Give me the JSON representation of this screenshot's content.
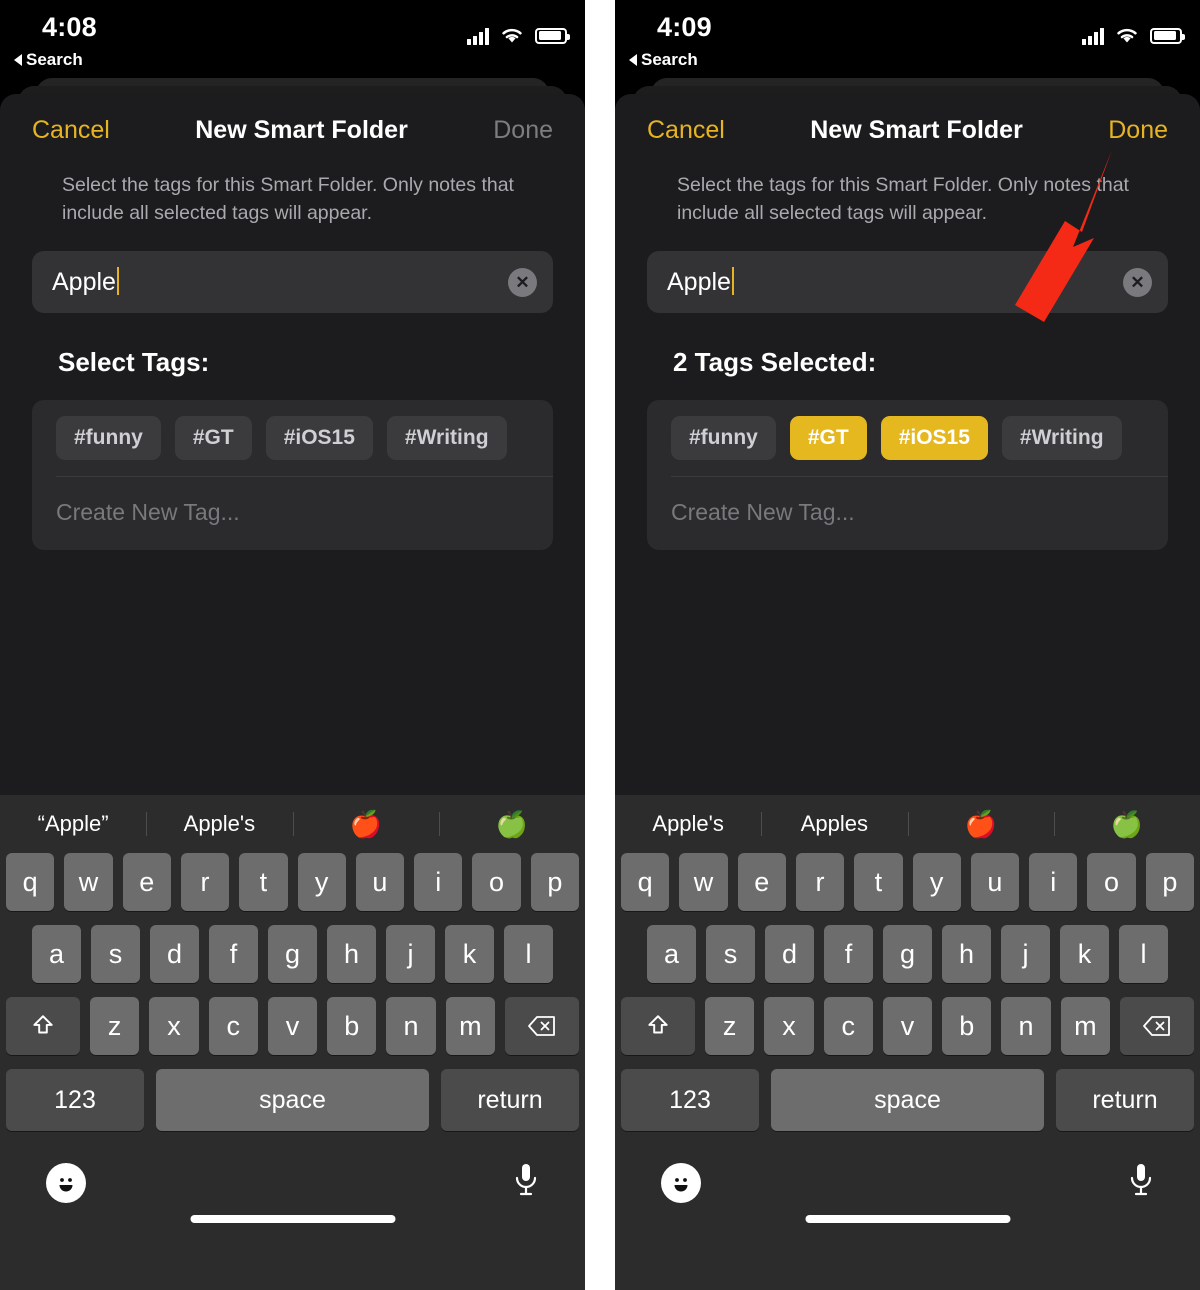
{
  "panels": [
    {
      "id": "before",
      "statusbar": {
        "time": "4:08",
        "back_label": "Search",
        "signal_icon": "cellular-signal-icon",
        "wifi_icon": "wifi-icon",
        "battery_icon": "battery-icon"
      },
      "nav": {
        "cancel": "Cancel",
        "title": "New Smart Folder",
        "done": "Done",
        "done_enabled": false
      },
      "description": "Select the tags for this Smart Folder. Only notes that include all selected tags will appear.",
      "name_field": {
        "value": "Apple",
        "clear_icon": "clear-circle-icon"
      },
      "section_title": "Select Tags:",
      "tags": [
        {
          "label": "#funny",
          "selected": false
        },
        {
          "label": "#GT",
          "selected": false
        },
        {
          "label": "#iOS15",
          "selected": false
        },
        {
          "label": "#Writing",
          "selected": false
        }
      ],
      "create_new_tag": "Create New Tag...",
      "suggestions": [
        "“Apple”",
        "Apple's",
        "🍎",
        "🍏"
      ]
    },
    {
      "id": "after",
      "statusbar": {
        "time": "4:09",
        "back_label": "Search",
        "signal_icon": "cellular-signal-icon",
        "wifi_icon": "wifi-icon",
        "battery_icon": "battery-icon"
      },
      "nav": {
        "cancel": "Cancel",
        "title": "New Smart Folder",
        "done": "Done",
        "done_enabled": true
      },
      "description": "Select the tags for this Smart Folder. Only notes that include all selected tags will appear.",
      "name_field": {
        "value": "Apple",
        "clear_icon": "clear-circle-icon"
      },
      "section_title": "2 Tags Selected:",
      "tags": [
        {
          "label": "#funny",
          "selected": false
        },
        {
          "label": "#GT",
          "selected": true
        },
        {
          "label": "#iOS15",
          "selected": true
        },
        {
          "label": "#Writing",
          "selected": false
        }
      ],
      "create_new_tag": "Create New Tag...",
      "suggestions": [
        "Apple's",
        "Apples",
        "🍎",
        "🍏"
      ]
    }
  ],
  "keyboard": {
    "row1": [
      "q",
      "w",
      "e",
      "r",
      "t",
      "y",
      "u",
      "i",
      "o",
      "p"
    ],
    "row2": [
      "a",
      "s",
      "d",
      "f",
      "g",
      "h",
      "j",
      "k",
      "l"
    ],
    "row3": [
      "z",
      "x",
      "c",
      "v",
      "b",
      "n",
      "m"
    ],
    "shift_icon": "shift-arrow-icon",
    "backspace_icon": "backspace-icon",
    "numbers_key": "123",
    "space_key": "space",
    "return_key": "return",
    "emoji_icon": "smiley-face-icon",
    "mic_icon": "microphone-icon",
    "home_indicator": "home-indicator"
  },
  "annotation": {
    "arrow_icon": "red-arrow-pointer",
    "color": "#F42A17",
    "points_to": "done-button"
  },
  "colors": {
    "accent_yellow": "#E6B422",
    "tag_selected": "#E6B81F",
    "tag_unselected": "#3B3B3D",
    "sheet_background": "#1C1C1E",
    "keyboard_background": "#2C2C2C",
    "key_background": "#6D6D6D",
    "key_fn_background": "#4B4B4B"
  }
}
